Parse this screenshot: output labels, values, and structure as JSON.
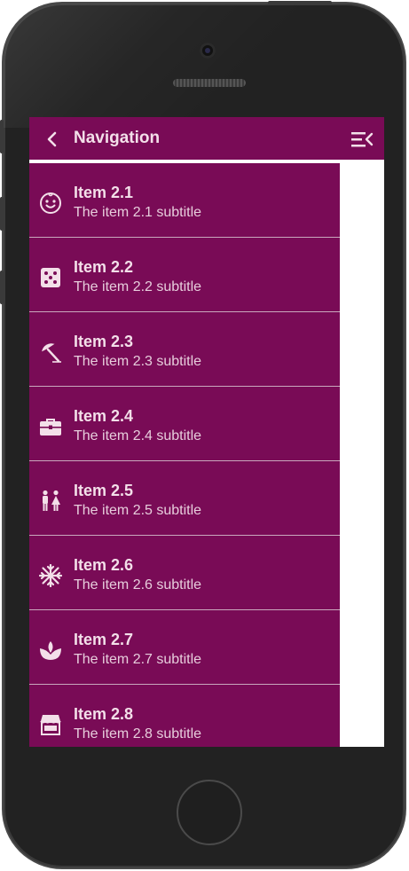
{
  "theme": {
    "accent": "#790b56",
    "text": "#f3dfe9",
    "subtext": "#e7cddc"
  },
  "header": {
    "title": "Navigation",
    "back_icon": "chevron-left-icon",
    "menu_icon": "menu-collapse-icon"
  },
  "items": [
    {
      "title": "Item 2.1",
      "subtitle": "The item 2.1 subtitle",
      "icon": "baby-face-icon"
    },
    {
      "title": "Item 2.2",
      "subtitle": "The item 2.2 subtitle",
      "icon": "dice-icon"
    },
    {
      "title": "Item 2.3",
      "subtitle": "The item 2.3 subtitle",
      "icon": "beach-umbrella-icon"
    },
    {
      "title": "Item 2.4",
      "subtitle": "The item 2.4 subtitle",
      "icon": "briefcase-icon"
    },
    {
      "title": "Item 2.5",
      "subtitle": "The item 2.5 subtitle",
      "icon": "restroom-icon"
    },
    {
      "title": "Item 2.6",
      "subtitle": "The item 2.6 subtitle",
      "icon": "snowflake-icon"
    },
    {
      "title": "Item 2.7",
      "subtitle": "The item 2.7 subtitle",
      "icon": "spa-icon"
    },
    {
      "title": "Item 2.8",
      "subtitle": "The item 2.8 subtitle",
      "icon": "store-icon"
    }
  ]
}
